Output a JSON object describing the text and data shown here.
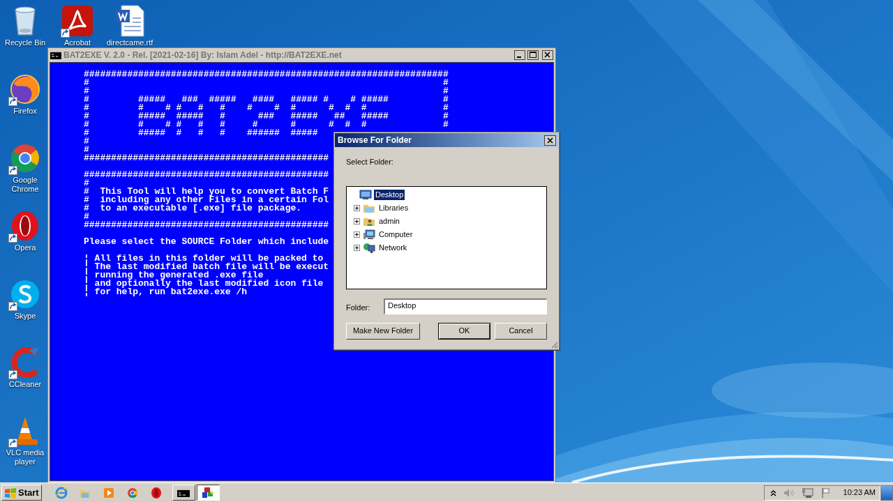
{
  "desktop_icons": [
    {
      "label": "Recycle Bin",
      "shortcut": false
    },
    {
      "label": "Acrobat",
      "shortcut": true
    },
    {
      "label": "directcame.rtf",
      "shortcut": false
    },
    {
      "label": "Firefox",
      "shortcut": true
    },
    {
      "label": "Google Chrome",
      "shortcut": true
    },
    {
      "label": "Opera",
      "shortcut": true
    },
    {
      "label": "Skype",
      "shortcut": true
    },
    {
      "label": "CCleaner",
      "shortcut": true
    },
    {
      "label": "VLC media player",
      "shortcut": true
    }
  ],
  "console": {
    "title": "BAT2EXE V. 2.0 - Rel. [2021-02-16] By: Islam Adel - http://BAT2EXE.net",
    "active": false,
    "blocks": [
      [
        "###################################################################",
        "#                                                                 #",
        "#                                                                 #",
        "#         #####   ###  #####   ####   ##### #    # #####          #",
        "#         #    # #   #   #    #    #  #      #  #  #              #",
        "#         #####  #####   #      ###   #####   ##   #####          #",
        "#         #    # #   #   #     #      #      #  #  #              #",
        "#         #####  #   #   #    ######  #####",
        "#",
        "#",
        "#############################################"
      ],
      [
        "#############################################",
        "#",
        "#  This Tool will help you to convert Batch F",
        "#  including any other Files in a certain Fol",
        "#  to an executable [.exe] file package.",
        "#",
        "#############################################"
      ],
      [
        "Please select the SOURCE Folder which include"
      ],
      [
        "¦ All files in this folder will be packed to",
        "¦ The last modified batch file will be execut",
        "¦ running the generated .exe file",
        "¦ and optionally the last modified icon file",
        "¦ for help, run bat2exe.exe /h"
      ]
    ]
  },
  "dialog": {
    "title": "Browse For Folder",
    "prompt": "Select Folder:",
    "tree": [
      {
        "label": "Desktop",
        "selected": true,
        "children": [
          {
            "label": "Libraries",
            "selected": false,
            "expanded": false
          },
          {
            "label": "admin",
            "selected": false,
            "expanded": false
          },
          {
            "label": "Computer",
            "selected": false,
            "expanded": false
          },
          {
            "label": "Network",
            "selected": false,
            "expanded": false
          }
        ]
      }
    ],
    "folder_label": "Folder:",
    "folder_value": "Desktop",
    "buttons": [
      {
        "label": "Make New Folder",
        "default": false
      },
      {
        "label": "OK",
        "default": true
      },
      {
        "label": "Cancel",
        "default": false
      }
    ]
  },
  "taskbar": {
    "start": "Start",
    "tasks": [
      {
        "selected": false
      },
      {
        "selected": true
      }
    ],
    "clock": "10:23 AM"
  }
}
